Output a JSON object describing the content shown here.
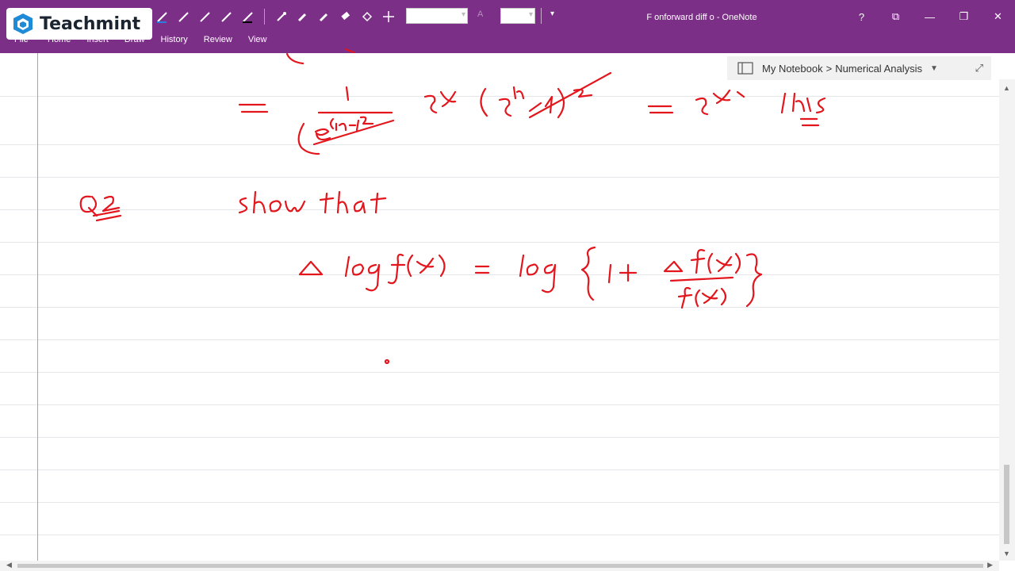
{
  "brand": {
    "name": "Teachmint"
  },
  "window": {
    "title": "F onforward diff o - OneNote"
  },
  "ribbon": {
    "tabs": [
      {
        "label": "File"
      },
      {
        "label": "Home"
      },
      {
        "label": "Insert"
      },
      {
        "label": "Draw"
      },
      {
        "label": "History"
      },
      {
        "label": "Review"
      },
      {
        "label": "View"
      }
    ],
    "font_size_hint": "A"
  },
  "notebook": {
    "name": "My Notebook",
    "separator": ">",
    "section": "Numerical Analysis"
  },
  "window_controls": [
    "help-icon",
    "fullscreen-icon",
    "minimize-icon",
    "restore-icon",
    "close-icon"
  ],
  "colors": {
    "ribbon_purple": "#7b2f86",
    "ink_red": "#e2161c",
    "margin_red": "#e28a8a",
    "rule_line": "#e4e6ea"
  }
}
